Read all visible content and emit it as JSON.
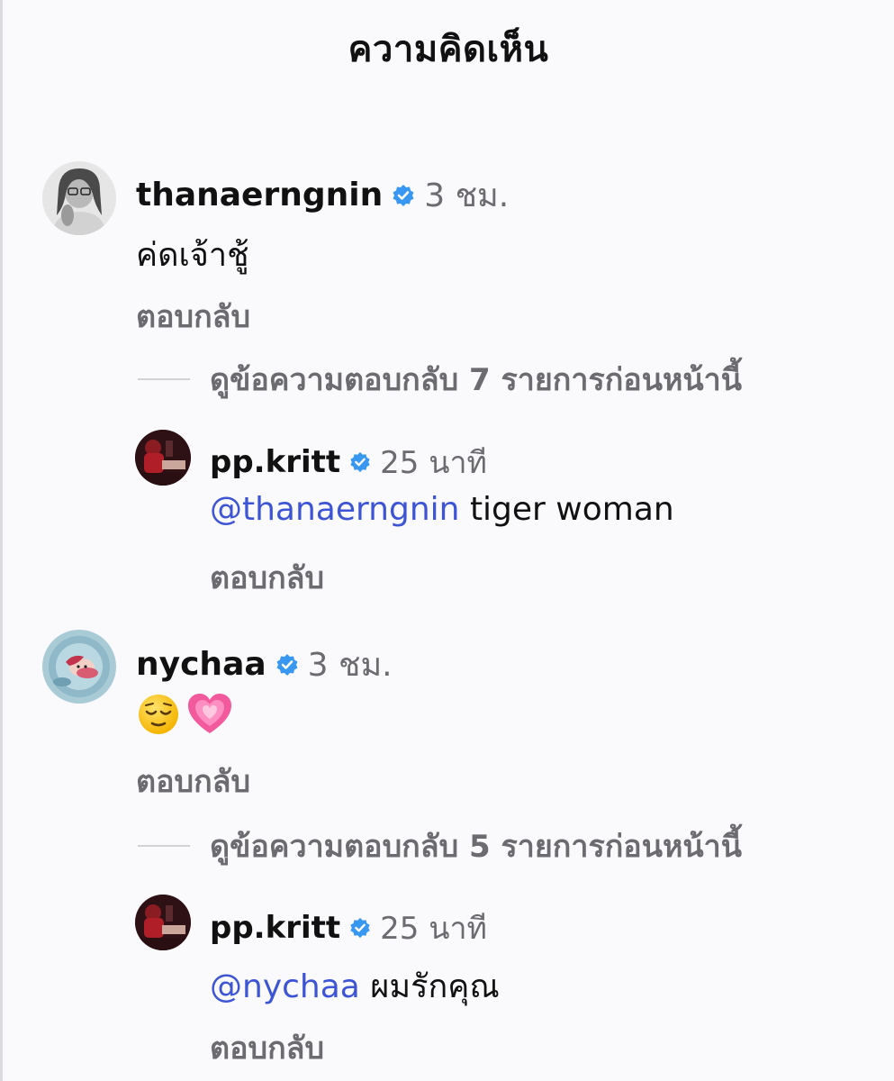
{
  "header": {
    "title": "ความคิดเห็น"
  },
  "comments": [
    {
      "username": "thanaerngnin",
      "time": "3 ชม.",
      "text": "ค่ดเจ้าชู้",
      "reply_label": "ตอบกลับ",
      "avatar": "thanaerngnin-avatar",
      "view_replies_label": "ดูข้อความตอบกลับ 7 รายการก่อนหน้านี้",
      "reply": {
        "username": "pp.kritt",
        "time": "25 นาที",
        "mention": "@thanaerngnin",
        "text": " tiger woman",
        "reply_label": "ตอบกลับ"
      }
    },
    {
      "username": "nychaa",
      "time": "3 ชม.",
      "emojis": [
        "relieved-face",
        "growing-heart"
      ],
      "reply_label": "ตอบกลับ",
      "view_replies_label": "ดูข้อความตอบกลับ 5 รายการก่อนหน้านี้",
      "reply": {
        "username": "pp.kritt",
        "time": "25 นาที",
        "mention": "@nychaa",
        "text": " ผมรักคุณ",
        "reply_label": "ตอบกลับ"
      }
    }
  ],
  "colors": {
    "mention": "#3d55d4",
    "verified": "#3897f0",
    "muted": "#6b6b70"
  }
}
